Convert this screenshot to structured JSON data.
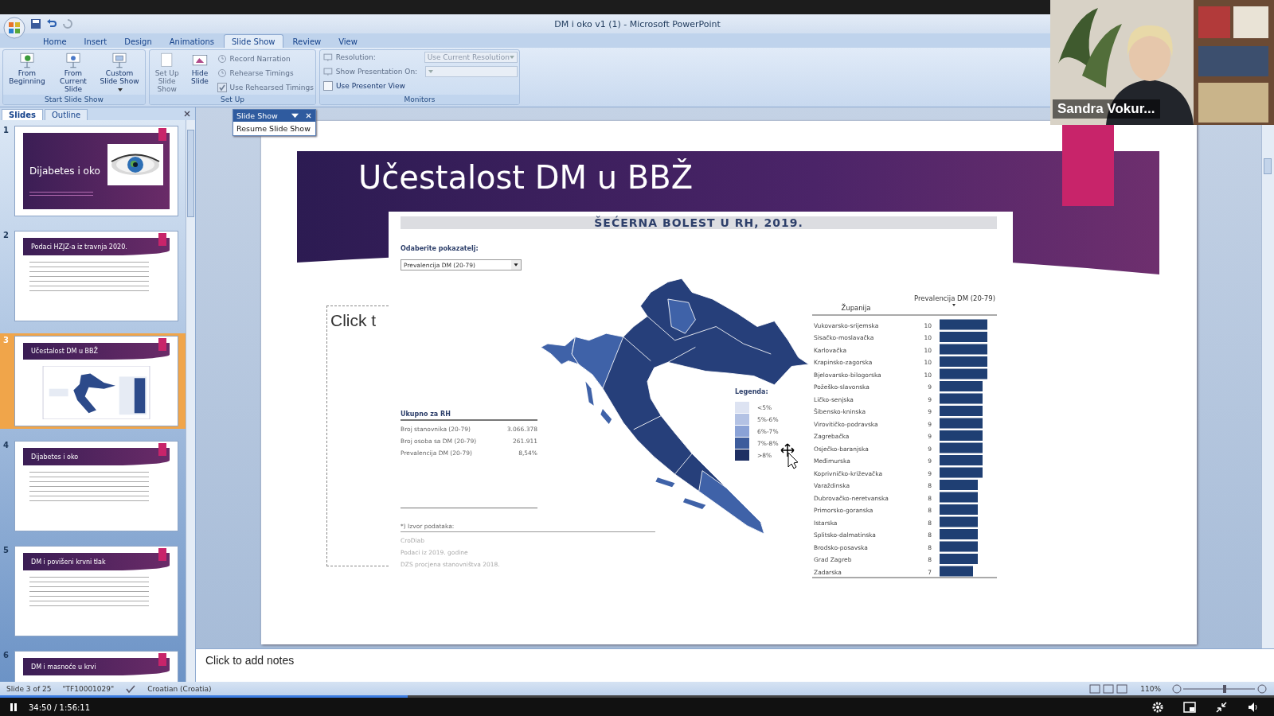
{
  "window": {
    "title": "DM i oko v1 (1) - Microsoft PowerPoint"
  },
  "ribbon_tabs": [
    {
      "label": "Home",
      "selected": false
    },
    {
      "label": "Insert",
      "selected": false
    },
    {
      "label": "Design",
      "selected": false
    },
    {
      "label": "Animations",
      "selected": false
    },
    {
      "label": "Slide Show",
      "selected": true
    },
    {
      "label": "Review",
      "selected": false
    },
    {
      "label": "View",
      "selected": false
    }
  ],
  "start_group": {
    "label": "Start Slide Show",
    "buttons": [
      {
        "kind": "beginning",
        "label": "From Beginning",
        "dropdown": false
      },
      {
        "kind": "current",
        "label": "From Current Slide",
        "dropdown": false
      },
      {
        "kind": "custom",
        "label": "Custom Slide Show",
        "dropdown": true
      }
    ]
  },
  "setup_group": {
    "label": "Set Up",
    "buttons": [
      {
        "kind": "setup",
        "label": "Set Up Slide Show",
        "disabled": true
      },
      {
        "kind": "hide",
        "label": "Hide Slide",
        "disabled": false
      }
    ],
    "items": [
      {
        "kind": "button",
        "label": "Record Narration",
        "disabled": true
      },
      {
        "kind": "button",
        "label": "Rehearse Timings",
        "disabled": true
      },
      {
        "kind": "checkbox",
        "label": "Use Rehearsed Timings",
        "disabled": true,
        "checked": true
      }
    ]
  },
  "monitors_group": {
    "label": "Monitors",
    "rows": [
      {
        "kind": "dropdown",
        "label": "Resolution:",
        "value": "Use Current Resolution",
        "disabled": true
      },
      {
        "kind": "dropdown",
        "label": "Show Presentation On:",
        "disabled": true
      },
      {
        "kind": "checkbox",
        "label": "Use Presenter View",
        "disabled": false,
        "checked": false
      }
    ]
  },
  "floating_toolbar": {
    "title": "Slide Show",
    "item": "Resume Slide Show"
  },
  "pane_tabs": [
    {
      "label": "Slides",
      "selected": true
    },
    {
      "label": "Outline",
      "selected": false
    }
  ],
  "slides": [
    {
      "number": "1",
      "title": "Dijabetes i oko",
      "kind": "title",
      "selected": false
    },
    {
      "number": "2",
      "title": "Podaci HZJZ-a iz travnja 2020.",
      "kind": "bullets",
      "selected": false
    },
    {
      "number": "3",
      "title": "Učestalost DM u BBŽ",
      "kind": "dashboard",
      "selected": true
    },
    {
      "number": "4",
      "title": "Dijabetes i oko",
      "kind": "bullets",
      "selected": false
    },
    {
      "number": "5",
      "title": "DM i povišeni krvni tlak",
      "kind": "bullets",
      "selected": false
    },
    {
      "number": "6",
      "title": "DM i masnoće u krvi",
      "kind": "header",
      "selected": false
    }
  ],
  "current_slide": {
    "title": "Učestalost DM u BBŽ",
    "placeholder": "Click t",
    "dashboard": {
      "title": "ŠEĆERNA BOLEST U RH, 2019.",
      "selector_label": "Odaberite pokazatelj:",
      "selector_value": "Prevalencija DM (20-79)",
      "totals": {
        "heading": "Ukupno za RH",
        "rows": [
          {
            "label": "Broj stanovnika (20-79)",
            "value": "3.066.378"
          },
          {
            "label": "Broj osoba sa DM (20-79)",
            "value": "261.911"
          },
          {
            "label": "Prevalencija DM (20-79)",
            "value": "8,54%"
          }
        ]
      },
      "source": {
        "heading": "*) Izvor podataka:",
        "lines": [
          "CroDiab",
          "Podaci iz 2019. godine",
          "DZS procjena stanovništva 2018."
        ]
      },
      "legend": {
        "title": "Legenda:",
        "items": [
          {
            "label": "<5%",
            "color": "#dde3f2"
          },
          {
            "label": "5%-6%",
            "color": "#b3c2e4"
          },
          {
            "label": "6%-7%",
            "color": "#8aa2d6"
          },
          {
            "label": "7%-8%",
            "color": "#3d5c9c"
          },
          {
            "label": ">8%",
            "color": "#1f2f63"
          }
        ]
      },
      "chart_data": {
        "type": "bar",
        "orientation": "horizontal",
        "ylabel": "Županija",
        "data_labels": true,
        "categories": [
          "Vukovarsko-srijemska",
          "Sisačko-moslavačka",
          "Karlovačka",
          "Krapinsko-zagorska",
          "Bjelovarsko-bilogorska",
          "Požeško-slavonska",
          "Ličko-senjska",
          "Šibensko-kninska",
          "Virovitičko-podravska",
          "Zagrebačka",
          "Osječko-baranjska",
          "Međimurska",
          "Koprivničko-križevačka",
          "Varaždinska",
          "Dubrovačko-neretvanska",
          "Primorsko-goranska",
          "Istarska",
          "Splitsko-dalmatinska",
          "Brodsko-posavska",
          "Grad Zagreb",
          "Zadarska"
        ],
        "series": [
          {
            "name": "Prevalencija DM (20-79)",
            "color": "#1f3f73",
            "values": [
              10,
              10,
              10,
              10,
              10,
              9,
              9,
              9,
              9,
              9,
              9,
              9,
              9,
              8,
              8,
              8,
              8,
              8,
              8,
              8,
              7
            ]
          }
        ]
      }
    }
  },
  "notes": {
    "placeholder": "Click to add notes"
  },
  "status_bar": {
    "slide": "Slide 3 of 25",
    "theme": "\"TF10001029\"",
    "language": "Croatian (Croatia)",
    "zoom": "110%"
  },
  "video": {
    "name": "Sandra Vokur..."
  },
  "player": {
    "time": "34:50 / 1:56:11",
    "level": 0.32
  }
}
